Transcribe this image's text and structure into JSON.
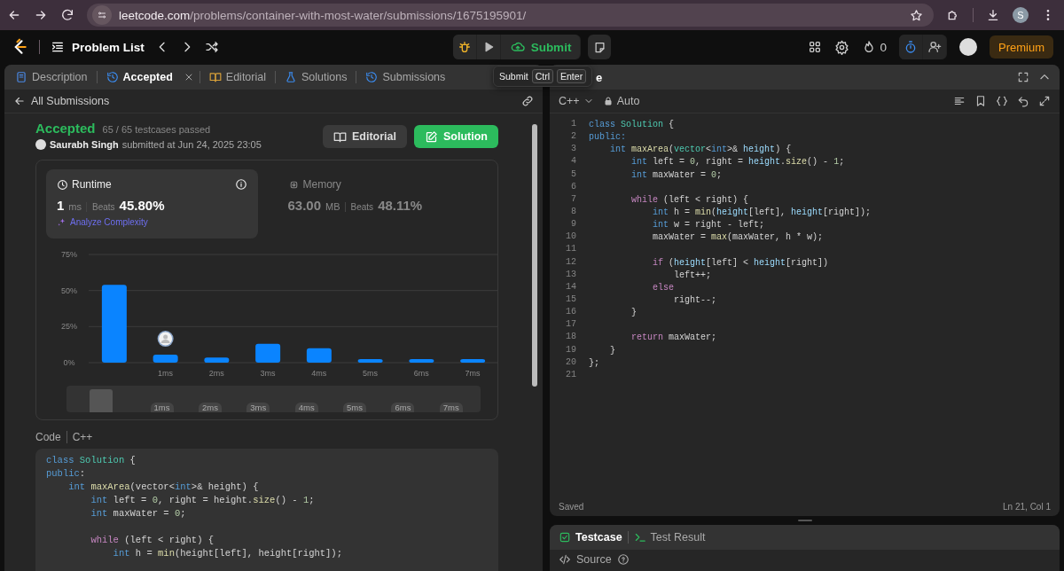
{
  "browser": {
    "url_host": "leetcode.com",
    "url_path": "/problems/container-with-most-water/submissions/1675195901/",
    "profile_initial": "S"
  },
  "nav": {
    "problem_list": "Problem List",
    "submit": "Submit",
    "streak": "0",
    "premium": "Premium"
  },
  "tooltip": {
    "label": "Submit",
    "keys": [
      "Ctrl",
      "Enter"
    ]
  },
  "left_panel": {
    "tabs": [
      {
        "label": "Description",
        "kind": "description",
        "selected": false,
        "closable": false
      },
      {
        "label": "Accepted",
        "kind": "accepted",
        "selected": true,
        "closable": true
      },
      {
        "label": "Editorial",
        "kind": "editorial",
        "selected": false,
        "closable": false
      },
      {
        "label": "Solutions",
        "kind": "solutions",
        "selected": false,
        "closable": false
      },
      {
        "label": "Submissions",
        "kind": "submissions",
        "selected": false,
        "closable": false
      }
    ],
    "back_link": "All Submissions",
    "result": {
      "status": "Accepted",
      "testcases": "65 / 65 testcases passed",
      "author": "Saurabh Singh",
      "submitted": "submitted at Jun 24, 2025 23:05"
    },
    "actions": [
      {
        "label": "Editorial",
        "kind": "editorial"
      },
      {
        "label": "Solution",
        "kind": "solution"
      }
    ],
    "stats": [
      {
        "title": "Runtime",
        "kind": "runtime",
        "selected": true,
        "info": true,
        "value": "1",
        "unit": "ms",
        "beats_label": "Beats",
        "beats": "45.80%",
        "link": "Analyze Complexity"
      },
      {
        "title": "Memory",
        "kind": "memory",
        "selected": false,
        "info": false,
        "value": "63.00",
        "unit": "MB",
        "beats_label": "Beats",
        "beats": "48.11%"
      }
    ],
    "chart_data": {
      "type": "bar",
      "categories": [
        null,
        "1ms",
        "2ms",
        "3ms",
        "4ms",
        "5ms",
        "6ms",
        "7ms"
      ],
      "values": [
        54,
        5.5,
        3.5,
        13,
        10,
        2.5,
        2.5,
        2.5
      ],
      "ylim": [
        0,
        75
      ],
      "yticks": [
        {
          "value": 0,
          "label": "0%"
        },
        {
          "value": 25,
          "label": "25%"
        },
        {
          "value": 50,
          "label": "50%"
        },
        {
          "value": 75,
          "label": "75%"
        }
      ],
      "annotations": [
        {
          "x": "1ms"
        }
      ]
    },
    "overview": {
      "level": 0.06,
      "labels": [
        "1ms",
        "2ms",
        "3ms",
        "4ms",
        "5ms",
        "6ms",
        "7ms"
      ]
    },
    "code_header": {
      "label": "Code",
      "language": "C++"
    },
    "code": [
      {
        "kind": "code",
        "tokens": [
          {
            "kind": "keyword",
            "text": "class"
          },
          {
            "kind": "type",
            "text": " Solution"
          },
          {
            "kind": "plain",
            "text": " {"
          }
        ]
      },
      {
        "kind": "code",
        "tokens": [
          {
            "kind": "keyword",
            "text": "public"
          },
          {
            "kind": "plain",
            "text": ":"
          }
        ]
      },
      {
        "kind": "code",
        "tokens": [
          {
            "kind": "keyword",
            "text": "    int"
          },
          {
            "kind": "function",
            "text": " maxArea"
          },
          {
            "kind": "plain",
            "text": "(vector<"
          },
          {
            "kind": "keyword",
            "text": "int"
          },
          {
            "kind": "plain",
            "text": ">& height) {"
          }
        ]
      },
      {
        "kind": "code",
        "tokens": [
          {
            "kind": "keyword",
            "text": "        int"
          },
          {
            "kind": "plain",
            "text": " left = "
          },
          {
            "kind": "number",
            "text": "0"
          },
          {
            "kind": "plain",
            "text": ", right = height."
          },
          {
            "kind": "function",
            "text": "size"
          },
          {
            "kind": "plain",
            "text": "() - "
          },
          {
            "kind": "number",
            "text": "1"
          },
          {
            "kind": "plain",
            "text": ";"
          }
        ]
      },
      {
        "kind": "code",
        "tokens": [
          {
            "kind": "keyword",
            "text": "        int"
          },
          {
            "kind": "plain",
            "text": " maxWater = "
          },
          {
            "kind": "number",
            "text": "0"
          },
          {
            "kind": "plain",
            "text": ";"
          }
        ]
      },
      {
        "kind": "blank"
      },
      {
        "kind": "code",
        "tokens": [
          {
            "kind": "control",
            "text": "        while"
          },
          {
            "kind": "plain",
            "text": " (left < right) {"
          }
        ]
      },
      {
        "kind": "code",
        "tokens": [
          {
            "kind": "keyword",
            "text": "            int"
          },
          {
            "kind": "plain",
            "text": " h = "
          },
          {
            "kind": "function",
            "text": "min"
          },
          {
            "kind": "plain",
            "text": "(height[left], height[right]);"
          }
        ]
      }
    ]
  },
  "right_panel": {
    "title_tail": "e",
    "language": "C++",
    "mode": "Auto",
    "lines": [
      {
        "n": "1",
        "tokens": [
          {
            "kind": "keyword",
            "text": "class"
          },
          {
            "kind": "type",
            "text": " Solution"
          },
          {
            "kind": "plain",
            "text": " {"
          }
        ]
      },
      {
        "n": "2",
        "tokens": [
          {
            "kind": "keyword",
            "text": "public:"
          }
        ]
      },
      {
        "n": "3",
        "tokens": [
          {
            "kind": "keyword",
            "text": "    int"
          },
          {
            "kind": "function",
            "text": " maxArea"
          },
          {
            "kind": "plain",
            "text": "("
          },
          {
            "kind": "type",
            "text": "vector"
          },
          {
            "kind": "plain",
            "text": "<"
          },
          {
            "kind": "keyword",
            "text": "int"
          },
          {
            "kind": "plain",
            "text": ">&"
          },
          {
            "kind": "variable",
            "text": " height"
          },
          {
            "kind": "plain",
            "text": ") {"
          }
        ]
      },
      {
        "n": "4",
        "tokens": [
          {
            "kind": "keyword",
            "text": "        int"
          },
          {
            "kind": "plain",
            "text": " left = "
          },
          {
            "kind": "number",
            "text": "0"
          },
          {
            "kind": "plain",
            "text": ", right ="
          },
          {
            "kind": "variable",
            "text": " height"
          },
          {
            "kind": "plain",
            "text": "."
          },
          {
            "kind": "function",
            "text": "size"
          },
          {
            "kind": "plain",
            "text": "() - "
          },
          {
            "kind": "number",
            "text": "1"
          },
          {
            "kind": "plain",
            "text": ";"
          }
        ]
      },
      {
        "n": "5",
        "tokens": [
          {
            "kind": "keyword",
            "text": "        int"
          },
          {
            "kind": "plain",
            "text": " maxWater = "
          },
          {
            "kind": "number",
            "text": "0"
          },
          {
            "kind": "plain",
            "text": ";"
          }
        ]
      },
      {
        "n": "6"
      },
      {
        "n": "7",
        "tokens": [
          {
            "kind": "control",
            "text": "        while"
          },
          {
            "kind": "plain",
            "text": " (left < right) {"
          }
        ]
      },
      {
        "n": "8",
        "tokens": [
          {
            "kind": "keyword",
            "text": "            int"
          },
          {
            "kind": "plain",
            "text": " h = "
          },
          {
            "kind": "function",
            "text": "min"
          },
          {
            "kind": "plain",
            "text": "("
          },
          {
            "kind": "variable",
            "text": "height"
          },
          {
            "kind": "plain",
            "text": "[left],"
          },
          {
            "kind": "variable",
            "text": " height"
          },
          {
            "kind": "plain",
            "text": "[right]);"
          }
        ]
      },
      {
        "n": "9",
        "tokens": [
          {
            "kind": "keyword",
            "text": "            int"
          },
          {
            "kind": "plain",
            "text": " w = right - left;"
          }
        ]
      },
      {
        "n": "10",
        "tokens": [
          {
            "kind": "plain",
            "text": "            maxWater = "
          },
          {
            "kind": "function",
            "text": "max"
          },
          {
            "kind": "plain",
            "text": "(maxWater, h * w);"
          }
        ]
      },
      {
        "n": "11"
      },
      {
        "n": "12",
        "tokens": [
          {
            "kind": "control",
            "text": "            if"
          },
          {
            "kind": "plain",
            "text": " ("
          },
          {
            "kind": "variable",
            "text": "height"
          },
          {
            "kind": "plain",
            "text": "[left] <"
          },
          {
            "kind": "variable",
            "text": " height"
          },
          {
            "kind": "plain",
            "text": "[right])"
          }
        ]
      },
      {
        "n": "13",
        "tokens": [
          {
            "kind": "plain",
            "text": "                left++;"
          }
        ]
      },
      {
        "n": "14",
        "tokens": [
          {
            "kind": "control",
            "text": "            else"
          }
        ]
      },
      {
        "n": "15",
        "tokens": [
          {
            "kind": "plain",
            "text": "                right--;"
          }
        ]
      },
      {
        "n": "16",
        "tokens": [
          {
            "kind": "plain",
            "text": "        }"
          }
        ]
      },
      {
        "n": "17"
      },
      {
        "n": "18",
        "tokens": [
          {
            "kind": "control",
            "text": "        return"
          },
          {
            "kind": "plain",
            "text": " maxWater;"
          }
        ]
      },
      {
        "n": "19",
        "tokens": [
          {
            "kind": "plain",
            "text": "    }"
          }
        ]
      },
      {
        "n": "20",
        "tokens": [
          {
            "kind": "plain",
            "text": "};"
          }
        ]
      },
      {
        "n": "21"
      }
    ],
    "status": "Saved",
    "cursor": "Ln 21, Col 1",
    "bottom_tabs": [
      {
        "label": "Testcase",
        "kind": "testcase",
        "selected": true
      },
      {
        "label": "Test Result",
        "kind": "result",
        "selected": false
      }
    ],
    "source_label": "Source"
  }
}
